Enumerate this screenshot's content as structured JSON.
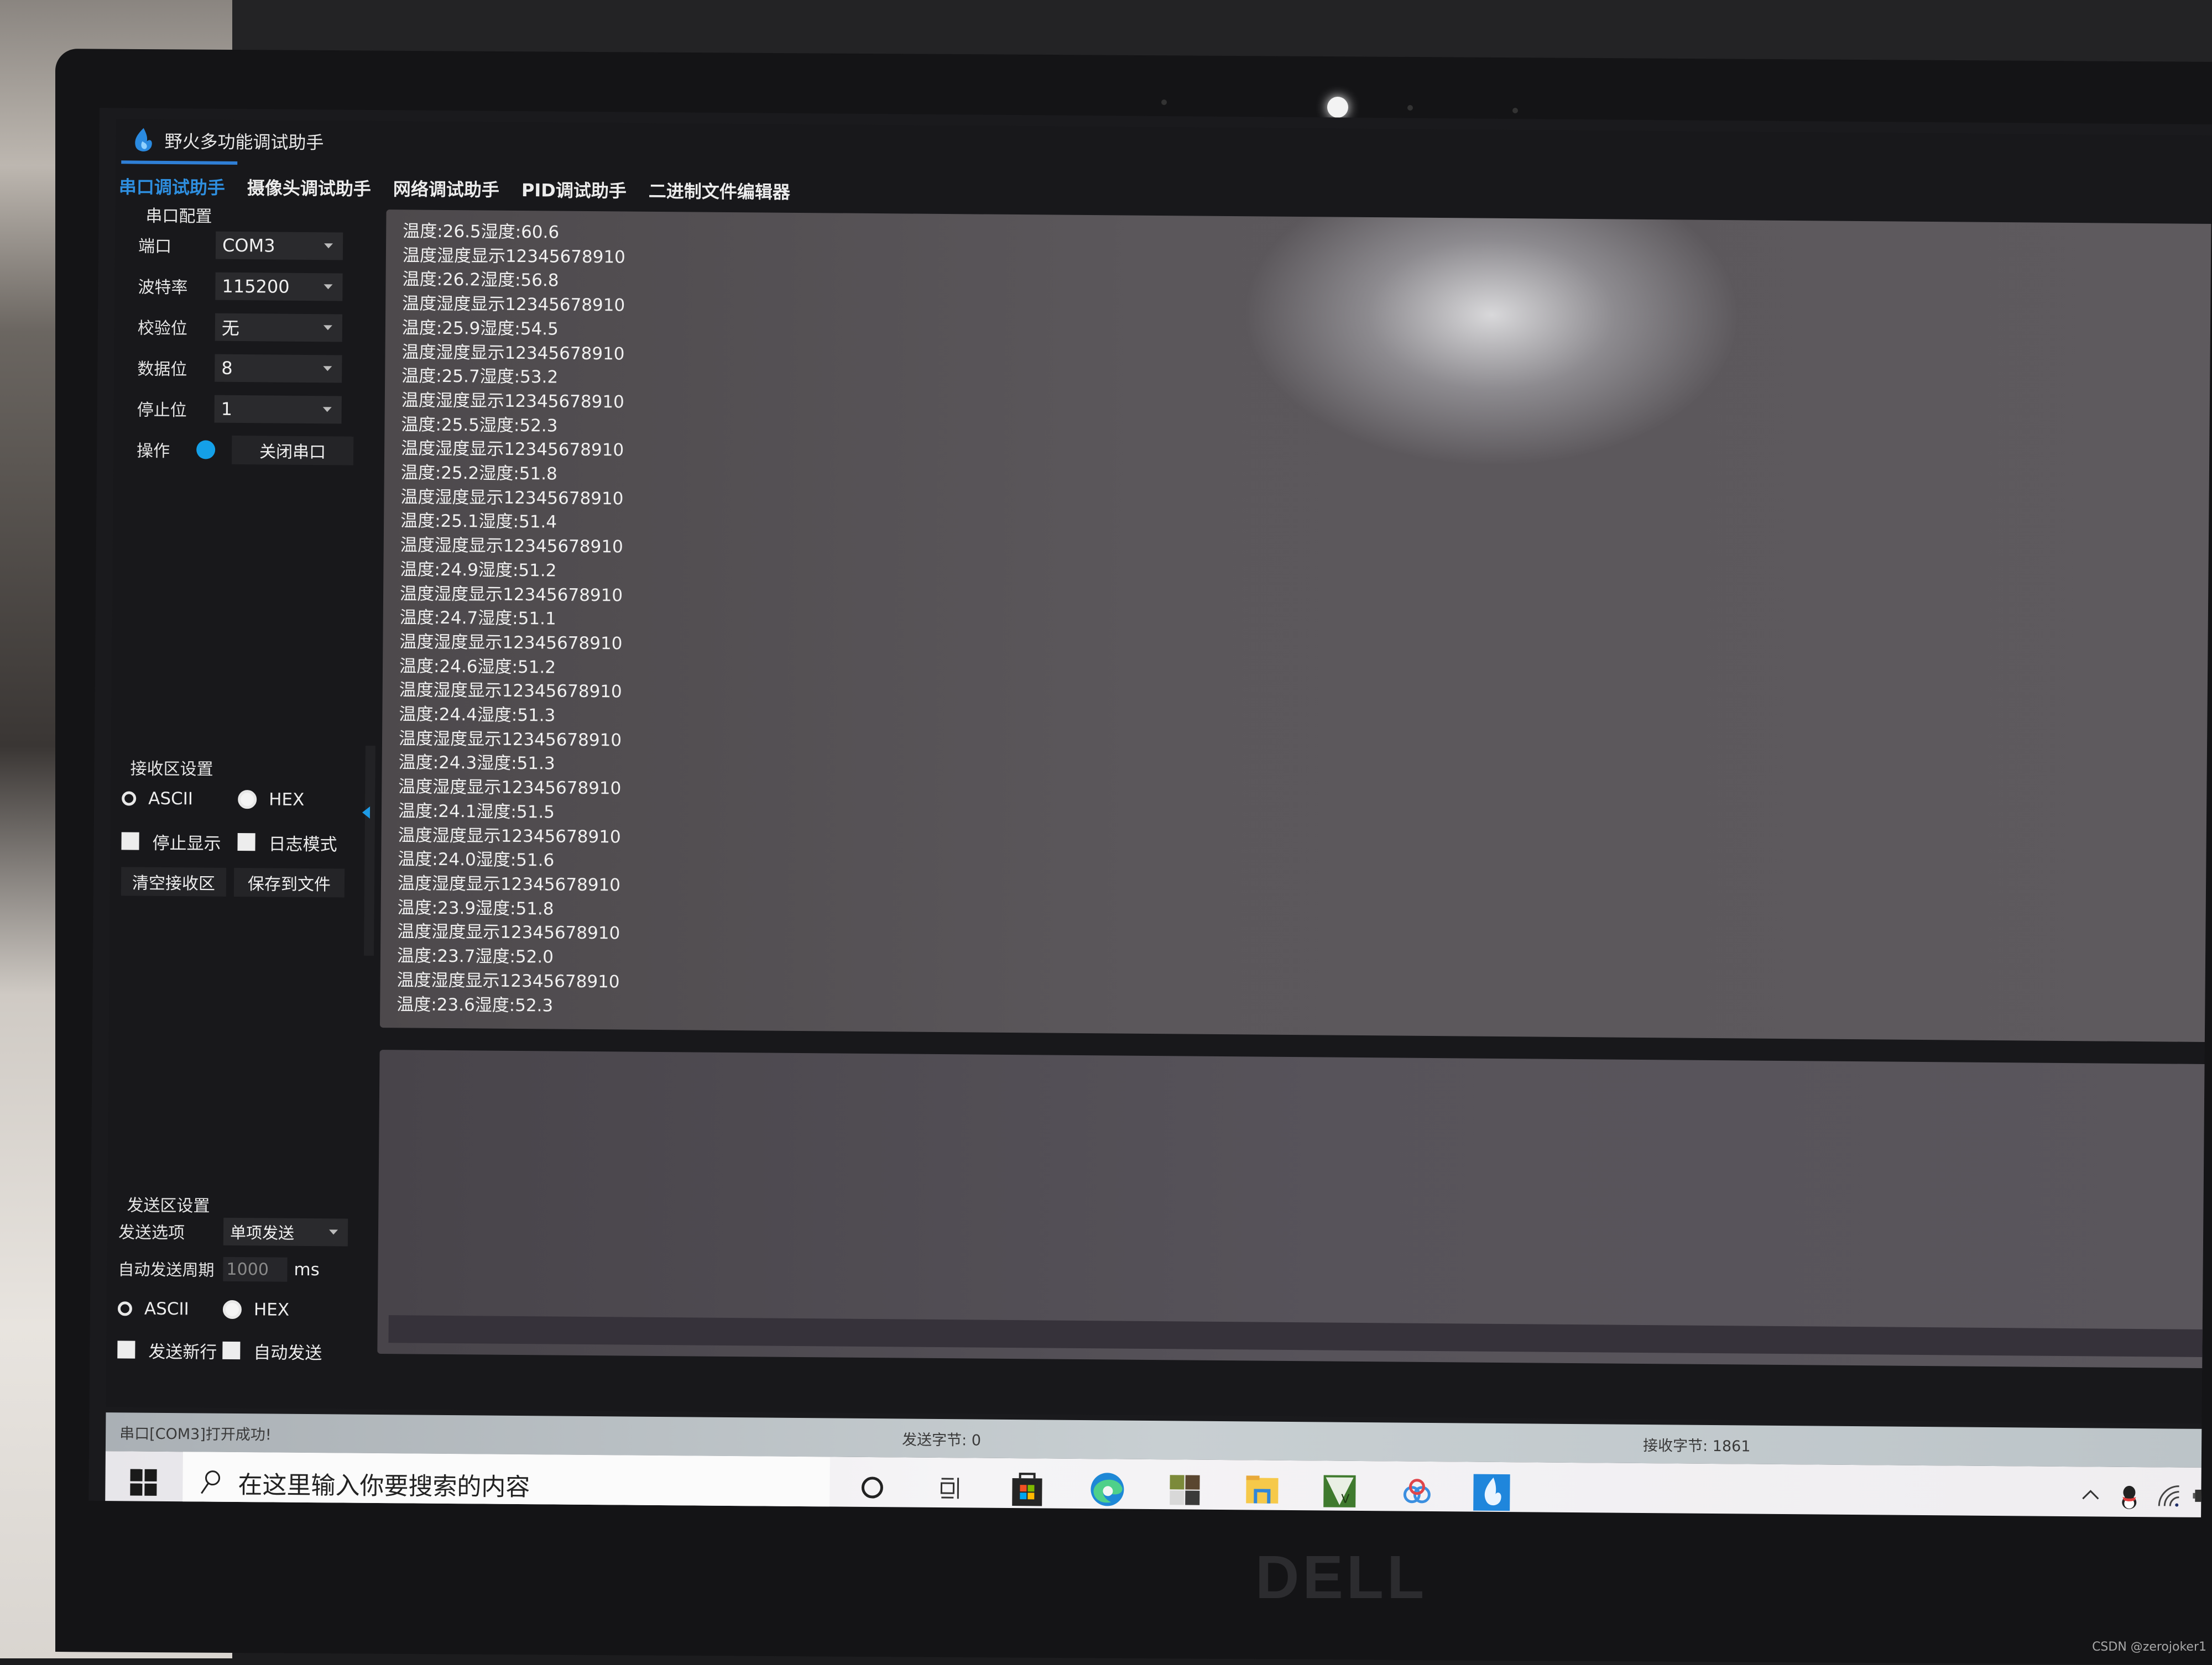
{
  "app": {
    "title": "野火多功能调试助手",
    "tabs": [
      {
        "label": "串口调试助手",
        "active": true
      },
      {
        "label": "摄像头调试助手",
        "active": false
      },
      {
        "label": "网络调试助手",
        "active": false
      },
      {
        "label": "PID调试助手",
        "active": false
      },
      {
        "label": "二进制文件编辑器",
        "active": false
      }
    ],
    "accent_color": "#2f7fd6"
  },
  "serial_config": {
    "title": "串口配置",
    "port": {
      "label": "端口",
      "value": "COM3"
    },
    "baud": {
      "label": "波特率",
      "value": "115200"
    },
    "parity": {
      "label": "校验位",
      "value": "无"
    },
    "data_bits": {
      "label": "数据位",
      "value": "8"
    },
    "stop_bits": {
      "label": "停止位",
      "value": "1"
    },
    "operation": {
      "label": "操作",
      "status_led_color": "#14a0e8",
      "button_label": "关闭串口"
    }
  },
  "receive_settings": {
    "title": "接收区设置",
    "ascii_label": "ASCII",
    "hex_label": "HEX",
    "selected_mode": "HEX",
    "stop_display_label": "停止显示",
    "log_mode_label": "日志模式",
    "clear_button": "清空接收区",
    "save_button": "保存到文件"
  },
  "send_settings": {
    "title": "发送区设置",
    "send_option_label": "发送选项",
    "send_option_value": "单项发送",
    "auto_period_label": "自动发送周期",
    "auto_period_value": "1000",
    "auto_period_unit": "ms",
    "ascii_label": "ASCII",
    "hex_label": "HEX",
    "selected_mode": "HEX",
    "send_newline_label": "发送新行",
    "auto_send_label": "自动发送"
  },
  "receive_area": {
    "lines": [
      "温度:26.5湿度:60.6",
      "温度湿度显示12345678910",
      "温度:26.2湿度:56.8",
      "温度湿度显示12345678910",
      "温度:25.9湿度:54.5",
      "温度湿度显示12345678910",
      "温度:25.7湿度:53.2",
      "温度湿度显示12345678910",
      "温度:25.5湿度:52.3",
      "温度湿度显示12345678910",
      "温度:25.2湿度:51.8",
      "温度湿度显示12345678910",
      "温度:25.1湿度:51.4",
      "温度湿度显示12345678910",
      "温度:24.9湿度:51.2",
      "温度湿度显示12345678910",
      "温度:24.7湿度:51.1",
      "温度湿度显示12345678910",
      "温度:24.6湿度:51.2",
      "温度湿度显示12345678910",
      "温度:24.4湿度:51.3",
      "温度湿度显示12345678910",
      "温度:24.3湿度:51.3",
      "温度湿度显示12345678910",
      "温度:24.1湿度:51.5",
      "温度湿度显示12345678910",
      "温度:24.0湿度:51.6",
      "温度湿度显示12345678910",
      "温度:23.9湿度:51.8",
      "温度湿度显示12345678910",
      "温度:23.7湿度:52.0",
      "温度湿度显示12345678910",
      "温度:23.6湿度:52.3"
    ]
  },
  "send_area": {
    "value": ""
  },
  "status_bar": {
    "message": "串口[COM3]打开成功!",
    "sent_bytes": "发送字节: 0",
    "received_bytes": "接收字节: 1861"
  },
  "taskbar": {
    "search_placeholder": "在这里输入你要搜索的内容",
    "pinned_icons": [
      "cortana-icon",
      "task-view-icon",
      "microsoft-store-icon",
      "edge-icon",
      "photo-app-icon",
      "file-explorer-icon",
      "vs-app-icon",
      "baidu-netdisk-icon",
      "firetool-app-icon"
    ],
    "tray_icons": [
      "show-hidden-icons-chevron",
      "qq-icon",
      "wifi-icon",
      "battery-icon"
    ]
  },
  "hardware": {
    "brand_logo": "DELL"
  },
  "watermark": "CSDN @zerojoker1"
}
